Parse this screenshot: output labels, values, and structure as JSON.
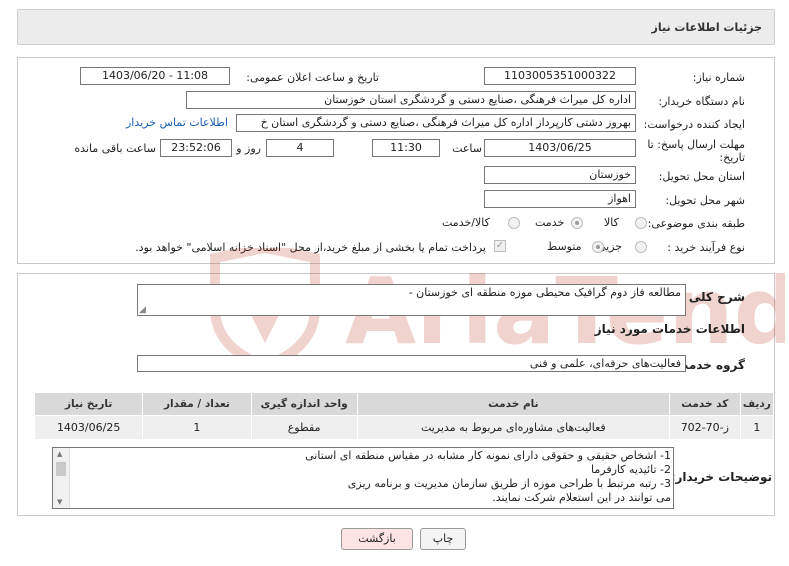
{
  "header": {
    "title": "جزئیات اطلاعات نیاز"
  },
  "form": {
    "need_number": {
      "label": "شماره نیاز:",
      "value": "1103005351000322"
    },
    "announce_datetime": {
      "label": "تاریخ و ساعت اعلان عمومی:",
      "value": "1403/06/20 - 11:08"
    },
    "buyer_org": {
      "label": "نام دستگاه خریدار:",
      "value": "اداره کل میراث فرهنگی ،صنایع دستی و گردشگری استان خوزستان"
    },
    "requester": {
      "label": "ایجاد کننده درخواست:",
      "value": "بهروز دشتی کارپرداز اداره کل میراث فرهنگی ،صنایع دستی و گردشگری استان خ"
    },
    "contact_link": "اطلاعات تماس خریدار",
    "deadline": {
      "label_line1": "مهلت ارسال پاسخ: تا",
      "label_line2": "تاریخ:",
      "date": "1403/06/25",
      "time_label": "ساعت",
      "time": "11:30",
      "days": "4",
      "days_label": "روز و",
      "remaining": "23:52:06",
      "remaining_label": "ساعت باقی مانده"
    },
    "province": {
      "label": "استان محل تحویل:",
      "value": "خوزستان"
    },
    "city": {
      "label": "شهر محل تحویل:",
      "value": "اهواز"
    },
    "category": {
      "label": "طبقه بندی موضوعی:",
      "options": [
        "کالا",
        "خدمت",
        "کالا/خدمت"
      ],
      "selected": "خدمت"
    },
    "purchase_type": {
      "label": "نوع فرآیند خرید :",
      "options": [
        "جزیی",
        "متوسط"
      ],
      "selected": "متوسط",
      "payment_note": "پرداخت تمام یا بخشی از مبلغ خرید،از محل \"اسناد خزانه اسلامی\" خواهد بود."
    }
  },
  "summary": {
    "label": "شرح کلی نیاز:",
    "value": "مطالعه فاز دوم گرافیک محیطی موزه منطقه ای خوزستان -"
  },
  "services": {
    "section_title": "اطلاعات خدمات مورد نیاز",
    "group_label": "گروه خدمت:",
    "group_value": "فعالیت‌های حرفه‌ای، علمی و فنی",
    "table": {
      "headers": [
        "ردیف",
        "کد خدمت",
        "نام خدمت",
        "واحد اندازه گیری",
        "تعداد / مقدار",
        "تاریخ نیاز"
      ],
      "rows": [
        [
          "1",
          "ز-70-702",
          "فعالیت‌های مشاوره‌ای مربوط به مدیریت",
          "مقطوع",
          "1",
          "1403/06/25"
        ]
      ]
    }
  },
  "notes": {
    "label": "توضیحات خریدار:",
    "lines": [
      "1- اشخاص حقیقی و حقوقی دارای نمونه کار مشابه در مقیاس منطقه ای استانی",
      "2- تائیدیه کارفرما",
      "3- رتبه مرتبط با طراحی موزه از طریق سازمان مدیریت و برنامه ریزی",
      "می توانند در این استعلام شرکت نمایند."
    ]
  },
  "buttons": {
    "print": "چاپ",
    "back": "بازگشت"
  },
  "colors": {
    "header_bg": "#ececec",
    "link": "#1a5fb4",
    "back_button_bg": "#fde3e3",
    "watermark": "#c0392b"
  }
}
